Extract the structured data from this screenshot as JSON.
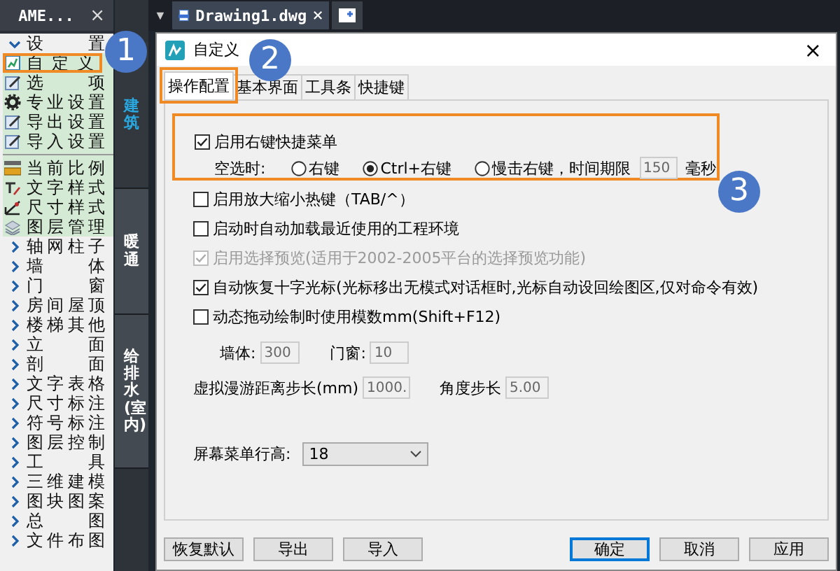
{
  "sidebar": {
    "title": "AME...",
    "close": "×",
    "tree": [
      {
        "label": "设 置",
        "expanded": true,
        "children": [
          {
            "kind": "item",
            "label": "自 定 义",
            "highlighted": true
          },
          {
            "kind": "item",
            "label": "选 项",
            "highlighted": false
          },
          {
            "kind": "item",
            "label": "专业设置",
            "highlighted": false
          },
          {
            "kind": "item",
            "label": "导出设置",
            "highlighted": false
          },
          {
            "kind": "item",
            "label": "导入设置",
            "highlighted": false
          },
          {
            "kind": "separator"
          },
          {
            "kind": "item",
            "label": "当前比例",
            "highlighted": false
          },
          {
            "kind": "item",
            "label": "文字样式",
            "highlighted": false
          },
          {
            "kind": "item",
            "label": "尺寸样式",
            "highlighted": false
          },
          {
            "kind": "item",
            "label": "图层管理",
            "highlighted": false
          }
        ]
      },
      {
        "label": "轴网柱子",
        "expanded": false
      },
      {
        "label": "墙 体",
        "expanded": false
      },
      {
        "label": "门 窗",
        "expanded": false
      },
      {
        "label": "房间屋顶",
        "expanded": false
      },
      {
        "label": "楼梯其他",
        "expanded": false
      },
      {
        "label": "立 面",
        "expanded": false
      },
      {
        "label": "剖 面",
        "expanded": false
      },
      {
        "label": "文字表格",
        "expanded": false
      },
      {
        "label": "尺寸标注",
        "expanded": false
      },
      {
        "label": "符号标注",
        "expanded": false
      },
      {
        "label": "图层控制",
        "expanded": false
      },
      {
        "label": "工 具",
        "expanded": false
      },
      {
        "label": "三维建模",
        "expanded": false
      },
      {
        "label": "图块图案",
        "expanded": false
      },
      {
        "label": "总 图",
        "expanded": false
      },
      {
        "label": "文件布图",
        "expanded": false
      }
    ]
  },
  "vertical_tabs": [
    {
      "label": "建筑",
      "selected": true
    },
    {
      "label": "暖通",
      "selected": false
    },
    {
      "label": "给排水(室内)",
      "selected": false
    }
  ],
  "document_tabs": {
    "menu": "▼",
    "tabs": [
      {
        "label": "Drawing1.dwg",
        "close": "×",
        "selected": true
      }
    ]
  },
  "dialog": {
    "title": "自定义",
    "close": "×",
    "tabs": [
      {
        "label": "操作配置",
        "selected": true,
        "highlighted": true
      },
      {
        "label": "基本界面",
        "selected": false,
        "highlighted": false
      },
      {
        "label": "工具条",
        "selected": false,
        "highlighted": false
      },
      {
        "label": "快捷键",
        "selected": false,
        "highlighted": false
      }
    ],
    "right_click_group": {
      "highlighted": true,
      "enable": {
        "label": "启用右键快捷菜单",
        "checked": true
      },
      "empty_selection_label": "空选时:",
      "options": [
        {
          "label": "右键",
          "selected": false
        },
        {
          "label": "Ctrl+右键",
          "selected": true
        },
        {
          "label": "慢击右键，时间期限",
          "selected": false
        }
      ],
      "time_limit": {
        "value": "150",
        "disabled": true
      },
      "unit": "毫秒"
    },
    "options": [
      {
        "label": "启用放大缩小热键（TAB/^）",
        "checked": false,
        "disabled": false
      },
      {
        "label": "启动时自动加载最近使用的工程环境",
        "checked": false,
        "disabled": false
      },
      {
        "label": "启用选择预览(适用于2002-2005平台的选择预览功能)",
        "checked": true,
        "disabled": true
      },
      {
        "label": "自动恢复十字光标(光标移出无模式对话框时,光标自动设回绘图区,仅对命令有效)",
        "checked": true,
        "disabled": false
      },
      {
        "label": "动态拖动绘制时使用模数mm(Shift+F12)",
        "checked": false,
        "disabled": false
      }
    ],
    "modulus_fields": [
      {
        "label": "墙体:",
        "value": "300",
        "disabled": true
      },
      {
        "label": "门窗:",
        "value": "10",
        "disabled": true
      }
    ],
    "step_fields": [
      {
        "label": "虚拟漫游距离步长(mm)",
        "value": "1000.",
        "disabled": true
      },
      {
        "label": "角度步长",
        "value": "5.00",
        "disabled": true
      }
    ],
    "row_height": {
      "label": "屏幕菜单行高:",
      "value": "18"
    },
    "left_buttons": [
      {
        "label": "恢复默认",
        "default": false
      },
      {
        "label": "导出",
        "default": false
      },
      {
        "label": "导入",
        "default": false
      }
    ],
    "right_buttons": [
      {
        "label": "确定",
        "default": true
      },
      {
        "label": "取消",
        "default": false
      },
      {
        "label": "应用",
        "default": false
      }
    ]
  },
  "annotations": [
    {
      "label": "1"
    },
    {
      "label": "2"
    },
    {
      "label": "3"
    }
  ]
}
